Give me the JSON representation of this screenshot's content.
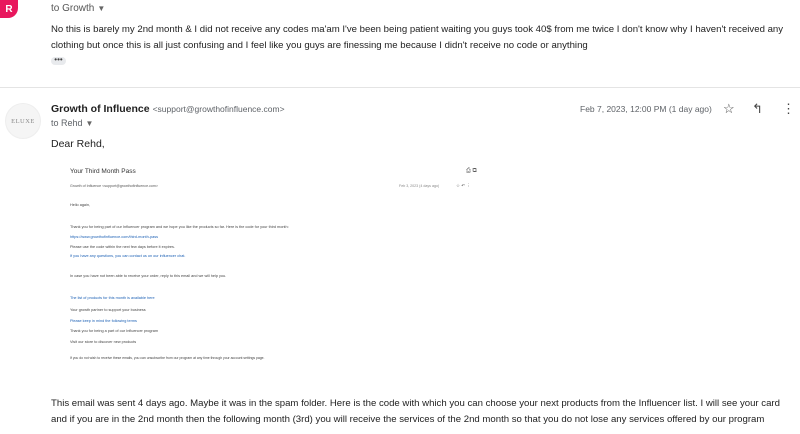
{
  "prev_message": {
    "avatar_letter": "R",
    "to_label": "to Growth",
    "body": "No this is barely my 2nd month & I did not receive any codes ma'am I've been being patient waiting you guys took 40$ from me twice I don't know why I haven't received any clothing but once this is all just confusing and I feel like you guys are finessing me because I didn't receive no code or anything",
    "expand_dots": "•••"
  },
  "current_message": {
    "logo_text": "ELUXE",
    "sender_name": "Growth of Influence",
    "sender_email": "<support@growthofinfluence.com>",
    "to_label": "to Rehd",
    "date": "Feb 7, 2023, 12:00 PM (1 day ago)",
    "greeting": "Dear Rehd,",
    "closing_text": "This email was sent 4 days ago. Maybe it was in the spam folder. Here is the code with which you can choose your next products from the Influencer list. I will see your card and if you are in the 2nd month then the following month (3rd) you will receive the services of the 2nd month so that you do not lose any services offered by our program"
  },
  "embedded_screenshot": {
    "title": "Your Third Month Pass",
    "icons": "⎙ ⧉",
    "sender_line": "Growth of Influence <support@growthofinfluence.com>",
    "meta_line": "Feb 3, 2023 (4 days ago)",
    "row_icons": "☆ ↶ ⋮",
    "lines": [
      {
        "text": "Hello again,",
        "style": "normal"
      },
      {
        "text": "Thank you for being part of our Influencer program and we hope you like the products so far. Here is the code for your third month:",
        "style": "normal"
      },
      {
        "text": "https://www.growthofinfluence.com/third-month-pass",
        "style": "blue"
      },
      {
        "text": "Please use the code within the next few days before it expires.",
        "style": "normal"
      },
      {
        "text": "If you have any questions, you can contact us on our influencer chat.",
        "style": "blue"
      },
      {
        "text": "In case you have not been able to receive your order, reply to this email and we will help you.",
        "style": "normal"
      },
      {
        "text": "The list of products for this month is available here",
        "style": "blue"
      },
      {
        "text": "Your growth partner to support your business",
        "style": "normal"
      },
      {
        "text": "Please keep in mind the following terms",
        "style": "blue"
      },
      {
        "text": "Thank you for being a part of our Influencer program",
        "style": "normal"
      },
      {
        "text": "Visit our store to discover new products",
        "style": "normal"
      },
      {
        "text": "If you do not wish to receive these emails, you can unsubscribe from our program at any time through your account settings page.",
        "style": "para"
      }
    ]
  },
  "colors": {
    "avatar": "#e8175d",
    "link": "#1a5fb4"
  }
}
